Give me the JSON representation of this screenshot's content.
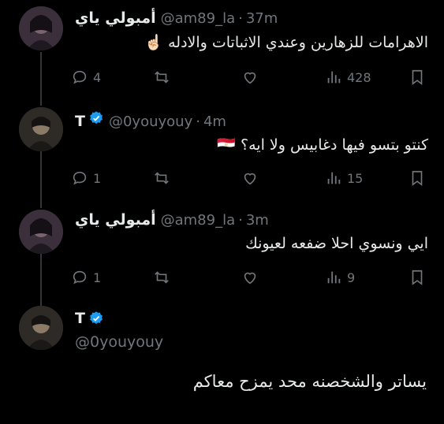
{
  "tweets": [
    {
      "name": "أمبولي ياي",
      "handle": "@am89_la",
      "time": "37m",
      "text": "الاهرامات للزهارين وعندي الاثباتات والادله ☝🏻",
      "reply_count": "4",
      "retweet_count": "",
      "like_count": "",
      "views": "428",
      "verified": false
    },
    {
      "name": "T",
      "handle": "@0youyouy",
      "time": "4m",
      "text": "كنتو بتسو فيها دغابيس ولا ايه؟ 🇪🇬",
      "reply_count": "1",
      "retweet_count": "",
      "like_count": "",
      "views": "15",
      "verified": true
    },
    {
      "name": "أمبولي ياي",
      "handle": "@am89_la",
      "time": "3m",
      "text": "ايي ونسوي احلا ضفعه لعيونك",
      "reply_count": "1",
      "retweet_count": "",
      "like_count": "",
      "views": "9",
      "verified": false
    }
  ],
  "main_tweet": {
    "name": "T",
    "handle": "@0youyouy",
    "text": "يساتر والشخصنه محد يمزح معاكم",
    "verified": true
  },
  "icons": [
    "reply-icon",
    "retweet-icon",
    "like-icon",
    "views-icon",
    "bookmark-icon",
    "verified-badge-icon"
  ],
  "colors": {
    "background": "#000000",
    "text": "#e7e9ea",
    "muted": "#71767b",
    "verified": "#1d9bf0",
    "thread_line": "#333639"
  }
}
